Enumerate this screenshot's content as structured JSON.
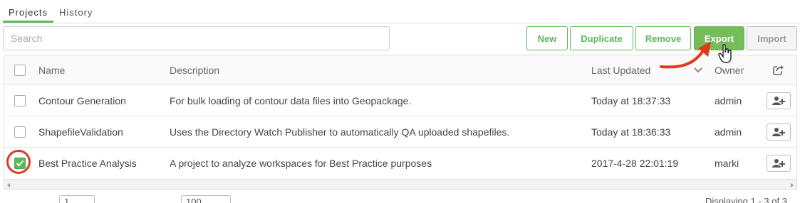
{
  "tabs": [
    {
      "label": "Projects",
      "active": true
    },
    {
      "label": "History",
      "active": false
    }
  ],
  "search": {
    "placeholder": "Search",
    "value": ""
  },
  "toolbar": {
    "new_label": "New",
    "duplicate_label": "Duplicate",
    "remove_label": "Remove",
    "export_label": "Export",
    "import_label": "Import"
  },
  "table": {
    "columns": {
      "name": "Name",
      "description": "Description",
      "last_updated": "Last Updated",
      "owner": "Owner"
    },
    "sort": {
      "column": "last_updated",
      "direction": "descending"
    },
    "rows": [
      {
        "name": "Contour Generation",
        "description": "For bulk loading of contour data files into Geopackage.",
        "last_updated": "Today at 18:37:33",
        "owner": "admin",
        "selected": false
      },
      {
        "name": "ShapefileValidation",
        "description": "Uses the Directory Watch Publisher to automatically QA uploaded shapefiles.",
        "last_updated": "Today at 18:36:33",
        "owner": "admin",
        "selected": false
      },
      {
        "name": "Best Practice Analysis",
        "description": "A project to analyze workspaces for Best Practice purposes",
        "last_updated": "2017-4-28 22:01:19",
        "owner": "marki",
        "selected": true
      }
    ]
  },
  "icons": {
    "header_action": "share-export-icon",
    "row_action": "share-user-icon",
    "sort": "chevron-down-icon"
  },
  "colors": {
    "accent": "#5cb85c",
    "primary_button": "#74bd5a",
    "annotation": "#e0391e"
  },
  "pager": {
    "page_value": "1",
    "page_size_value": "100",
    "status": "Displaying 1 - 3 of 3"
  }
}
